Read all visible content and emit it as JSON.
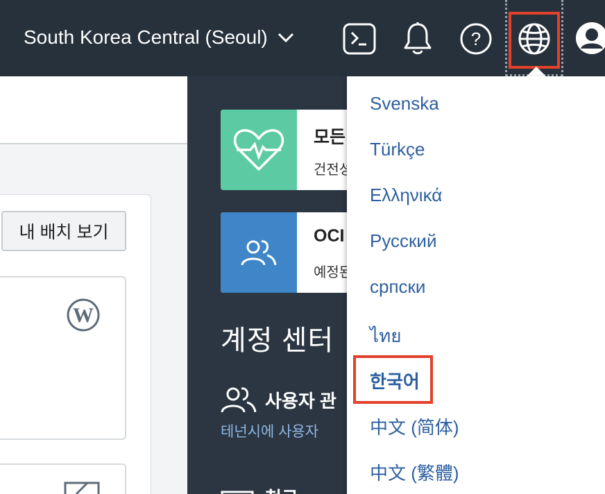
{
  "header": {
    "region_label": "South Korea Central (Seoul)",
    "icons": [
      "cloud-shell-icon",
      "bell-icon",
      "help-icon",
      "globe-icon",
      "user-avatar-icon"
    ]
  },
  "left": {
    "view_button_label": "내 배치 보기"
  },
  "cards": [
    {
      "title": "모든",
      "subtitle": "건전성",
      "color": "#5ccba4",
      "icon": "heart-monitor-icon"
    },
    {
      "title": "OCI",
      "subtitle": "예정된",
      "color": "#3f86c9",
      "icon": "users-icon"
    }
  ],
  "account_center": {
    "title": "계정 센터",
    "user_management_label": "사용자 관",
    "user_management_desc": "테넌시에 사용자",
    "next_item_label": "청구"
  },
  "language_menu": {
    "items": [
      "Svenska",
      "Türkçe",
      "Ελληνικά",
      "Русский",
      "српски",
      "ไทย",
      "한국어",
      "中文 (简体)",
      "中文 (繁體)"
    ],
    "selected": "한국어"
  },
  "colors": {
    "topbar": "#27313c",
    "highlight": "#e2412b",
    "link": "#2d5fa0"
  }
}
